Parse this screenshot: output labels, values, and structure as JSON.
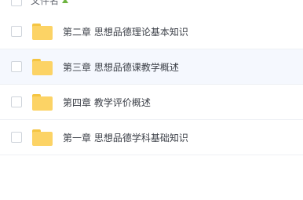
{
  "header": {
    "column_label": "文件名",
    "sort_icon": "triangle-up-icon",
    "sort_color": "#6db33f"
  },
  "files": [
    {
      "name": "第二章 思想品德理论基本知识",
      "icon": "folder-icon",
      "highlighted": false
    },
    {
      "name": "第三章 思想品德课教学概述",
      "icon": "folder-icon",
      "highlighted": true
    },
    {
      "name": "第四章 教学评价概述",
      "icon": "folder-icon",
      "highlighted": false
    },
    {
      "name": "第一章 思想品德学科基础知识",
      "icon": "folder-icon",
      "highlighted": false
    }
  ],
  "colors": {
    "folder": "#fcd365",
    "row_highlight": "#f5f8fe",
    "text": "#3b3f47"
  }
}
